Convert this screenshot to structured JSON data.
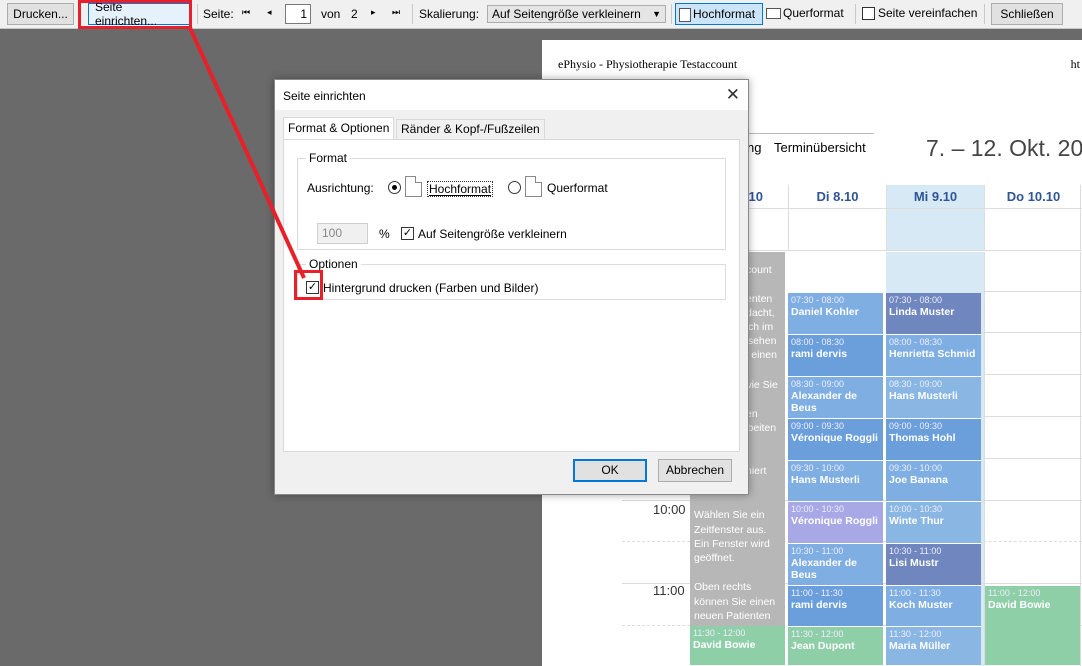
{
  "toolbar": {
    "print_label": "Drucken...",
    "page_setup_label": "Seite einrichten...",
    "page_label": "Seite:",
    "current_page": "1",
    "of_label": "von",
    "total_pages": "2",
    "scaling_label": "Skalierung:",
    "scaling_value": "Auf Seitengröße verkleinern",
    "portrait_label": "Hochformat",
    "landscape_label": "Querformat",
    "simplify_label": "Seite vereinfachen",
    "close_label": "Schließen"
  },
  "preview": {
    "header_left": "ePhysio - Physiotherapie Testaccount",
    "header_right": "ht",
    "view_tab_partial": "ng",
    "view_tab_overview": "Terminübersicht",
    "date_range": "7. – 12. Okt. 20",
    "days": [
      "10",
      "Di 8.10",
      "Mi 9.10",
      "Do 10.10"
    ],
    "times": [
      "10:00",
      "11:00"
    ],
    "grey_texts": [
      "count",
      "enten",
      "dacht,",
      "ch im",
      "nsehen",
      "l einen",
      "wie Sie",
      "en",
      "rbeiten",
      "niert",
      "Wählen Sie ein",
      "Zeitfenster aus.",
      "Ein Fenster wird",
      "geöffnet.",
      "Oben rechts",
      "können Sie einen",
      "neuen Patienten"
    ],
    "appointments_col_a": [
      {
        "time": "11:30 - 12:00",
        "name": "David Bowie"
      }
    ],
    "appointments_col_b": [
      {
        "time": "07:30 - 08:00",
        "name": "Daniel Kohler"
      },
      {
        "time": "08:00 - 08:30",
        "name": "rami dervis"
      },
      {
        "time": "08:30 - 09:00",
        "name": "Alexander de Beus"
      },
      {
        "time": "09:00 - 09:30",
        "name": "Véronique Roggli"
      },
      {
        "time": "09:30 - 10:00",
        "name": "Hans Musterli"
      },
      {
        "time": "10:00 - 10:30",
        "name": "Véronique Roggli"
      },
      {
        "time": "10:30 - 11:00",
        "name": "Alexander de Beus"
      },
      {
        "time": "11:00 - 11:30",
        "name": "rami dervis"
      },
      {
        "time": "11:30 - 12:00",
        "name": "Jean Dupont"
      }
    ],
    "appointments_col_c": [
      {
        "time": "07:30 - 08:00",
        "name": "Linda Muster"
      },
      {
        "time": "08:00 - 08:30",
        "name": "Henrietta Schmid"
      },
      {
        "time": "08:30 - 09:00",
        "name": "Hans Musterli"
      },
      {
        "time": "09:00 - 09:30",
        "name": "Thomas Hohl"
      },
      {
        "time": "09:30 - 10:00",
        "name": "Joe Banana"
      },
      {
        "time": "10:00 - 10:30",
        "name": "Winte Thur"
      },
      {
        "time": "10:30 - 11:00",
        "name": "Lisi Mustr"
      },
      {
        "time": "11:00 - 11:30",
        "name": "Koch Muster"
      },
      {
        "time": "11:30 - 12:00",
        "name": "Maria Müller"
      }
    ],
    "appointments_col_d": [
      {
        "time": "11:00 - 12:00",
        "name": "David Bowie"
      }
    ]
  },
  "dialog": {
    "title": "Seite einrichten",
    "tab_format": "Format & Optionen",
    "tab_margins": "Ränder & Kopf-/Fußzeilen",
    "group_format": "Format",
    "orientation_label": "Ausrichtung:",
    "portrait_label": "Hochformat",
    "landscape_label": "Querformat",
    "scale_value": "100",
    "percent_sign": "%",
    "shrink_label": "Auf Seitengröße verkleinern",
    "group_options": "Optionen",
    "print_background_label": "Hintergrund drucken (Farben und Bilder)",
    "ok_label": "OK",
    "cancel_label": "Abbrechen"
  },
  "colors": {
    "highlight": "#e8202a",
    "appt_blue": "#7faee2",
    "appt_dark": "#6f86be",
    "appt_green": "#8ecfa8",
    "appt_purple": "#a8a8e6",
    "grey_column": "#b7b7b7"
  }
}
